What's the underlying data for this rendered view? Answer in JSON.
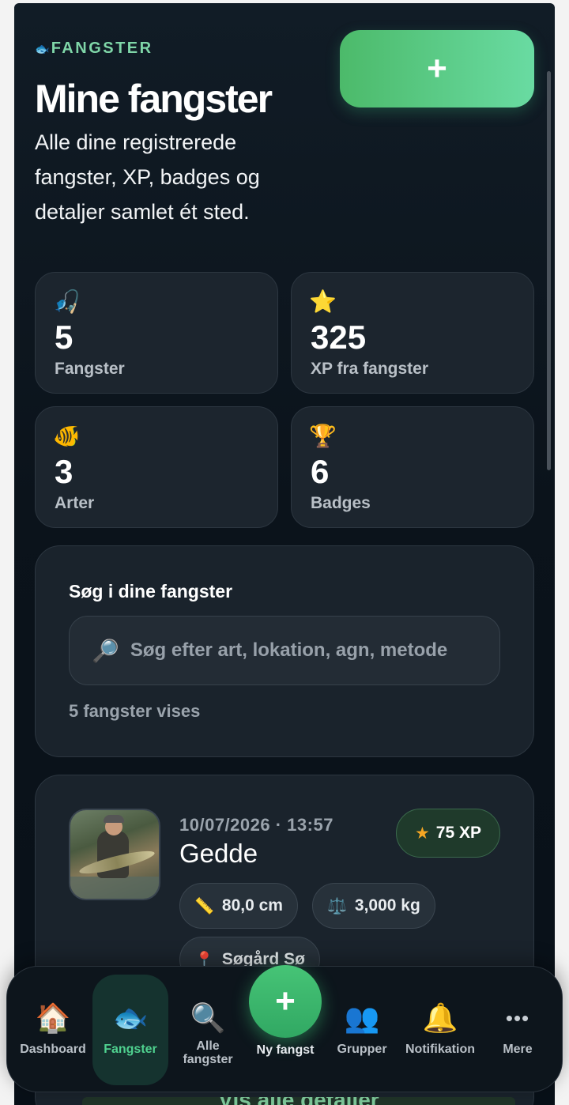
{
  "brand": {
    "icon": "fish-icon",
    "name": "FANGSTER"
  },
  "header": {
    "title": "Mine fangster",
    "subtitle": "Alle dine registrerede fangster, XP, badges og detaljer samlet ét sted.",
    "add_label": "+"
  },
  "stats": [
    {
      "icon": "🎣",
      "value": "5",
      "label": "Fangster"
    },
    {
      "icon": "⭐",
      "value": "325",
      "label": "XP fra fangster"
    },
    {
      "icon": "🐠",
      "value": "3",
      "label": "Arter"
    },
    {
      "icon": "🏆",
      "value": "6",
      "label": "Badges"
    }
  ],
  "search": {
    "heading": "Søg i dine fangster",
    "icon": "🔎",
    "placeholder": "Søg efter art, lokation, agn, metode",
    "count_text": "5 fangster vises"
  },
  "catch": {
    "datetime": "10/07/2026 · 13:57",
    "species": "Gedde",
    "xp": "75 XP",
    "length": "80,0 cm",
    "weight": "3,000 kg",
    "location": "Søgård Sø",
    "details_button": "Vis alle detaljer"
  },
  "nav": {
    "items": [
      {
        "icon": "🏠",
        "label": "Dashboard"
      },
      {
        "icon": "🐟",
        "label": "Fangster"
      },
      {
        "icon": "🔍",
        "label": "Alle fangster"
      },
      {
        "icon": "+",
        "label": "Ny fangst"
      },
      {
        "icon": "👥",
        "label": "Grupper"
      },
      {
        "icon": "🔔",
        "label": "Notifikation"
      },
      {
        "icon": "•••",
        "label": "Mere"
      }
    ],
    "active": "Fangster"
  },
  "colors": {
    "accent": "#4fd18f",
    "background": "#0b131b",
    "card": "#1a232c"
  }
}
